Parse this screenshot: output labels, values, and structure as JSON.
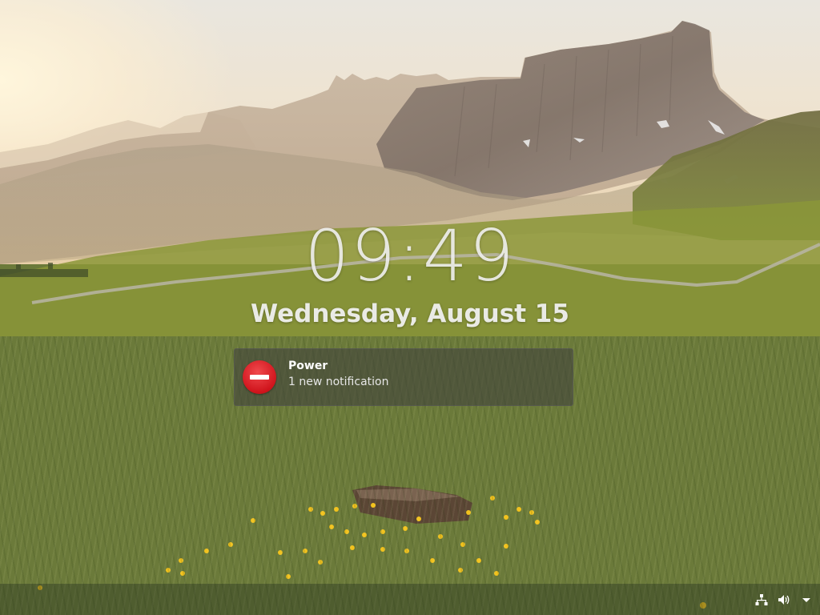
{
  "lockscreen": {
    "time": "09:49",
    "date": "Wednesday, August 15"
  },
  "notification": {
    "icon": "stop-sign-icon",
    "title": "Power",
    "body": "1 new notification"
  },
  "panel": {
    "tray": [
      {
        "icon": "network-icon"
      },
      {
        "icon": "volume-icon"
      },
      {
        "icon": "menu-arrow-icon"
      }
    ]
  },
  "colors": {
    "notification_icon": "#d0141c",
    "text": "#f5f5f5"
  }
}
